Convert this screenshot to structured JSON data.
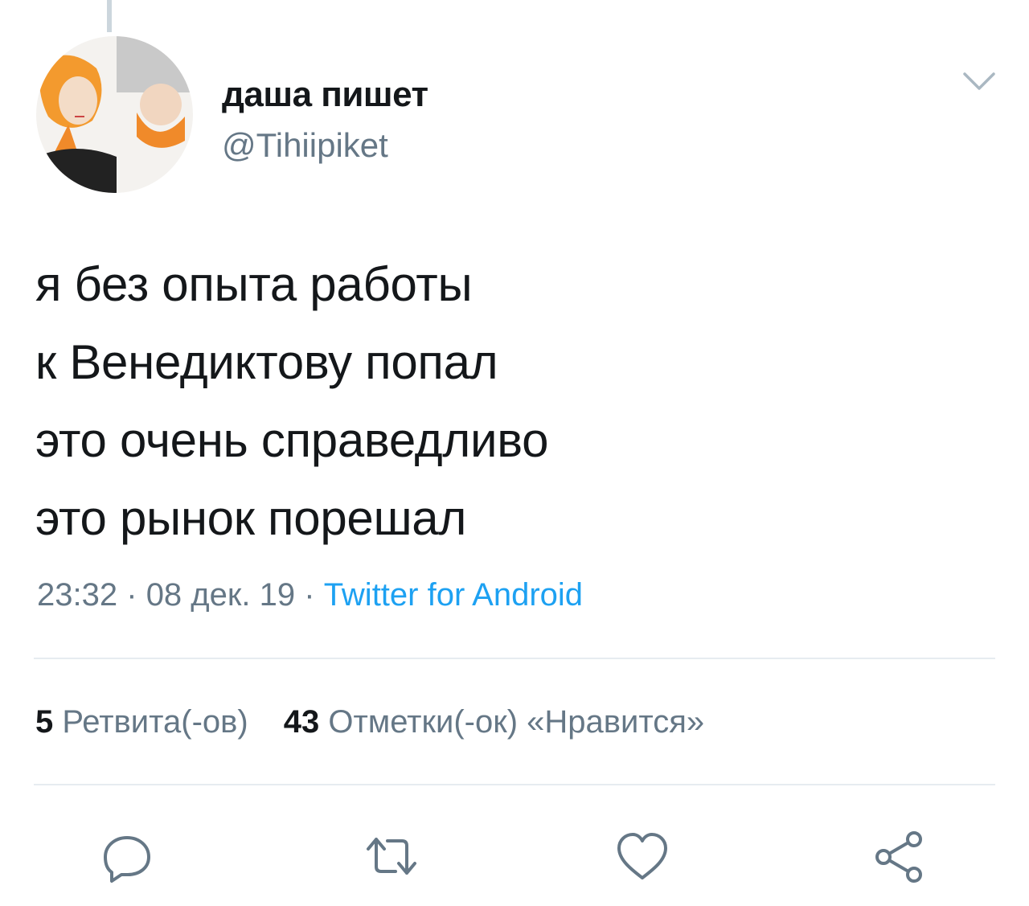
{
  "tweet": {
    "author": {
      "display_name": "даша пишет",
      "handle": "@Tihiipiket"
    },
    "text_lines": [
      "я без опыта работы",
      "к Венедиктову попал",
      "это очень справедливо",
      "это рынок порешал"
    ],
    "time": "23:32",
    "date": "08 дек. 19",
    "separator": "·",
    "source": "Twitter for Android",
    "stats": {
      "retweets_count": "5",
      "retweets_label": "Ретвита(-ов)",
      "likes_count": "43",
      "likes_label": "Отметки(-ок) «Нравится»"
    }
  },
  "icons": {
    "caret": "chevron-down-icon",
    "reply": "reply-icon",
    "retweet": "retweet-icon",
    "like": "heart-icon",
    "share": "share-icon"
  },
  "colors": {
    "text_primary": "#14171a",
    "text_secondary": "#657786",
    "link": "#1da1f2",
    "divider": "#e6ecf0"
  }
}
